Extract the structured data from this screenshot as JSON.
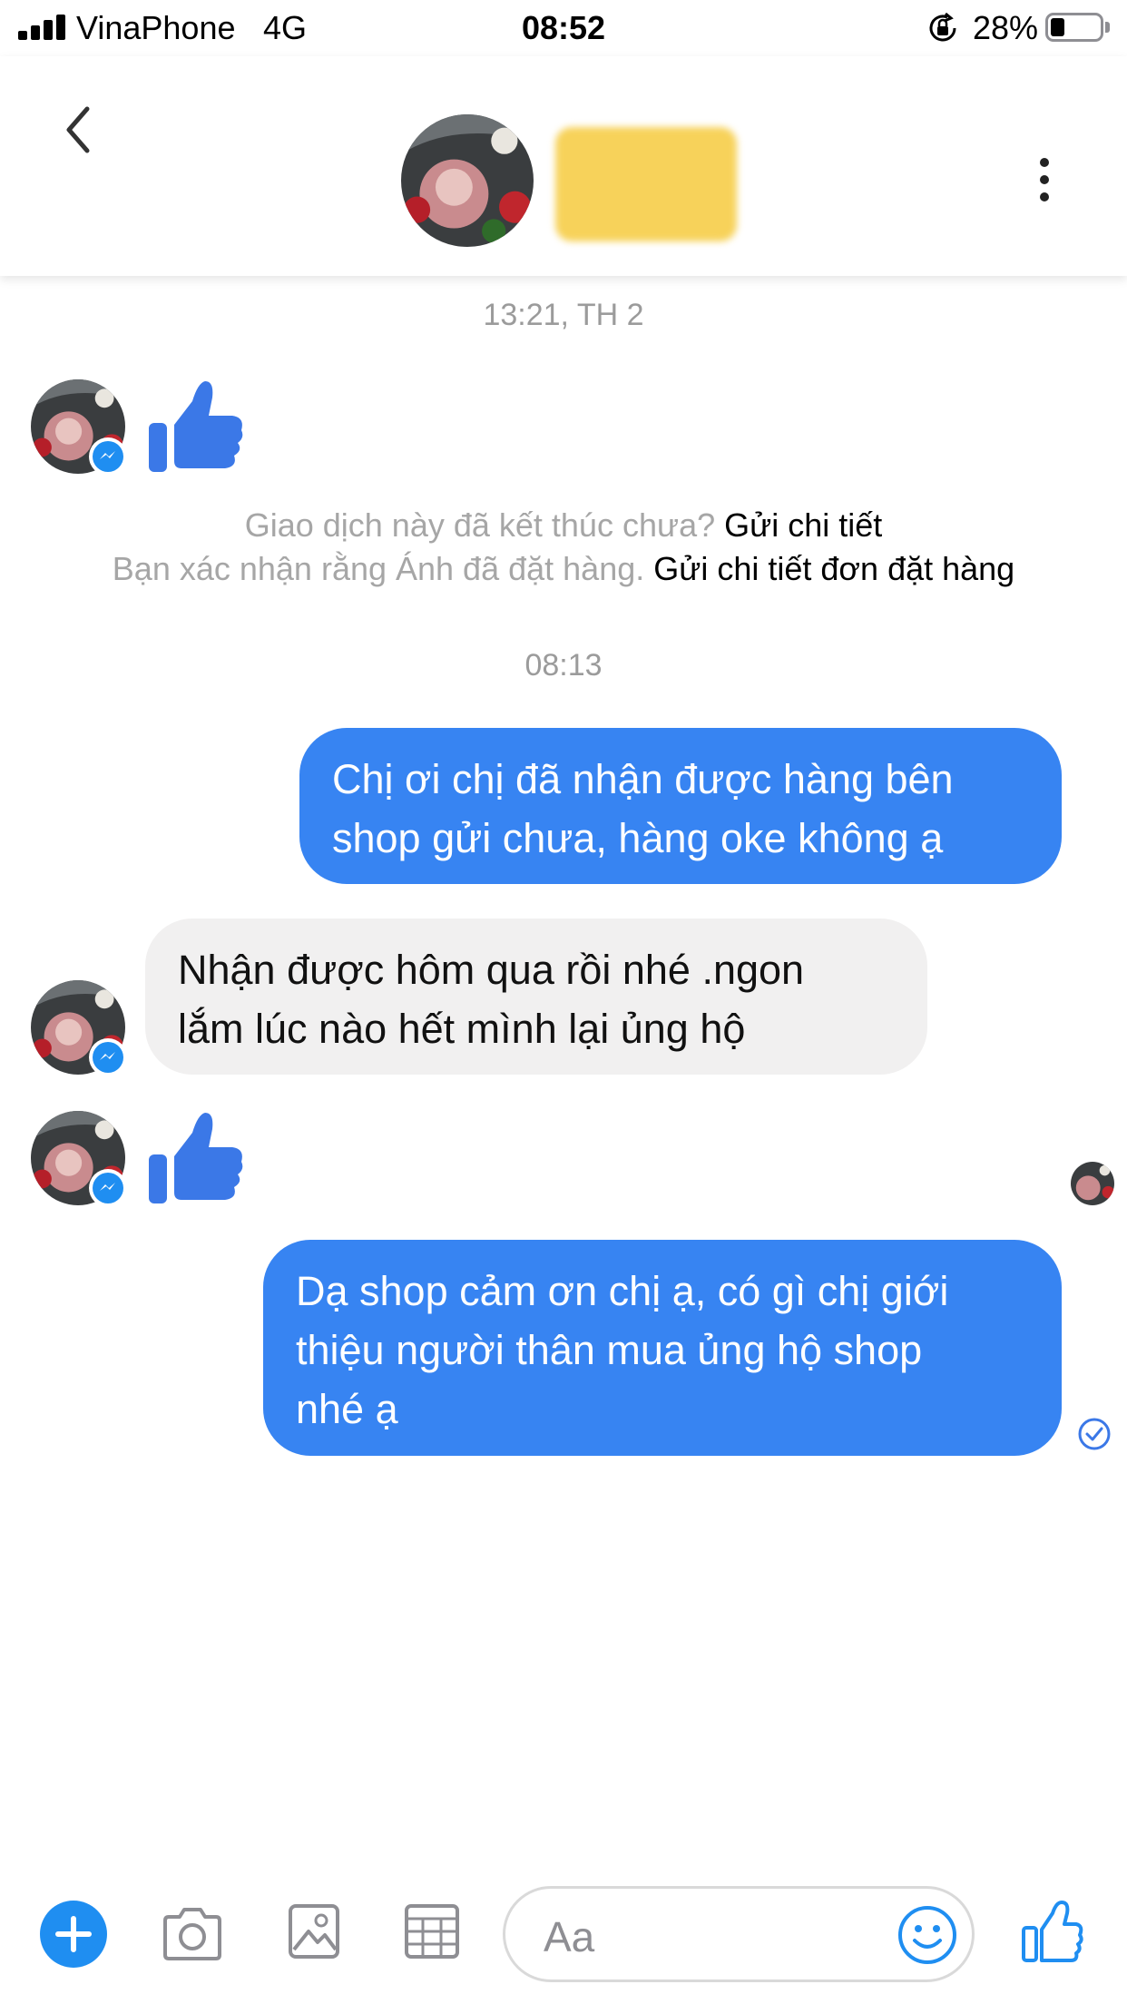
{
  "status_bar": {
    "carrier": "VinaPhone",
    "network": "4G",
    "time": "08:52",
    "battery_percent": "28%",
    "battery_level": 0.28
  },
  "header": {
    "back_icon": "chevron-left-icon",
    "more_icon": "vertical-ellipsis-icon"
  },
  "conversation": {
    "timestamp_1": "13:21, TH 2",
    "system_line_1": {
      "text": "Giao dịch này đã kết thúc chưa?",
      "link": "Gửi chi tiết"
    },
    "system_line_2": {
      "text": "Bạn xác nhận rằng Ánh đã đặt hàng.",
      "link": "Gửi chi tiết đơn đặt hàng"
    },
    "timestamp_2": "08:13",
    "messages": [
      {
        "direction": "out",
        "lines": [
          "Chị ơi chị đã nhận được hàng bên",
          "shop gửi chưa, hàng oke không ạ"
        ]
      },
      {
        "direction": "in",
        "lines": [
          "Nhận được hôm qua rồi nhé  .ngon",
          "lắm lúc nào hết mình lại ủng hộ"
        ]
      },
      {
        "direction": "out",
        "lines": [
          "Dạ shop cảm ơn chị ạ, có gì chị giới",
          "thiệu người thân mua ủng hộ shop",
          "nhé ạ"
        ]
      }
    ]
  },
  "composer": {
    "placeholder": "Aa"
  },
  "colors": {
    "accent": "#1f8ef1",
    "outgoing_bubble": "#3784f2",
    "incoming_bubble": "#f1f0f0",
    "thumb": "#3b78e7"
  }
}
